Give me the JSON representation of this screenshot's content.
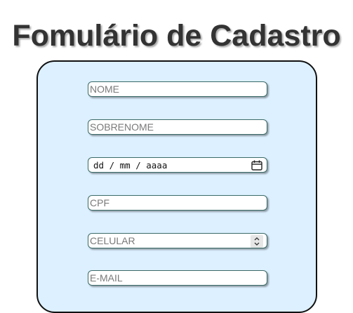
{
  "page": {
    "title": "Fomulário de Cadastro"
  },
  "form": {
    "nome": {
      "placeholder": "NOME"
    },
    "sobrenome": {
      "placeholder": "SOBRENOME"
    },
    "nascimento": {
      "value": "dd / mm / aaaa",
      "icon": "calendar-icon"
    },
    "cpf": {
      "placeholder": "CPF"
    },
    "celular": {
      "placeholder": "CELULAR",
      "icon": "spinner-arrows-icon"
    },
    "email": {
      "placeholder": "E-MAIL"
    }
  },
  "colors": {
    "card_background": "#dcf0ff",
    "field_border": "#3b6a68",
    "title_text": "#333333"
  }
}
